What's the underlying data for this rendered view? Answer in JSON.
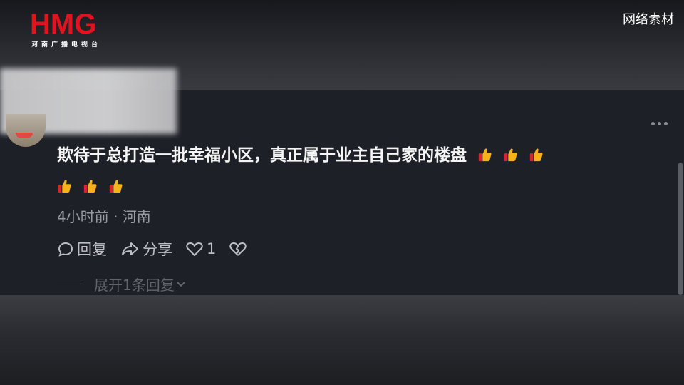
{
  "logo": {
    "brand": "HMG",
    "subtitle": "河南广播电视台"
  },
  "watermark": "网络素材",
  "comment": {
    "text": "欺待于总打造一批幸福小区，真正属于业主自己家的楼盘",
    "emoji": "thumbs-up-icon",
    "emoji_count_line1": 3,
    "emoji_count_line2": 3,
    "meta": "4小时前 · 河南",
    "actions": {
      "reply_label": "回复",
      "share_label": "分享",
      "like_count": "1"
    },
    "expand_label": "展开1条回复"
  },
  "colors": {
    "logo_red": "#e0131f",
    "panel": "#1e2027",
    "thumb": "#f5b21b"
  }
}
